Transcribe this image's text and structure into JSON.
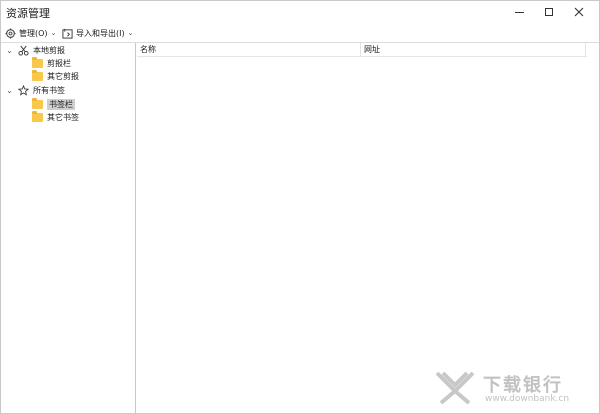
{
  "window": {
    "title": "资源管理"
  },
  "toolbar": {
    "manage_label": "管理(O)",
    "import_export_label": "导入和导出(I)"
  },
  "tree": {
    "local_clipboard": "本地剪报",
    "clip_bar": "剪报栏",
    "other_clips": "其它剪报",
    "all_bookmarks": "所有书签",
    "bookmark_bar": "书签栏",
    "other_bookmarks": "其它书签"
  },
  "list": {
    "columns": {
      "name": "名称",
      "url": "网址"
    }
  },
  "watermark": {
    "brand": "下载银行",
    "url": "www.downbank.cn"
  },
  "colors": {
    "folder": "#f9c84a",
    "selection": "#cfcfcf"
  },
  "icons": [
    "gear-icon",
    "import-export-icon",
    "scissors-icon",
    "star-icon",
    "folder-icon"
  ]
}
